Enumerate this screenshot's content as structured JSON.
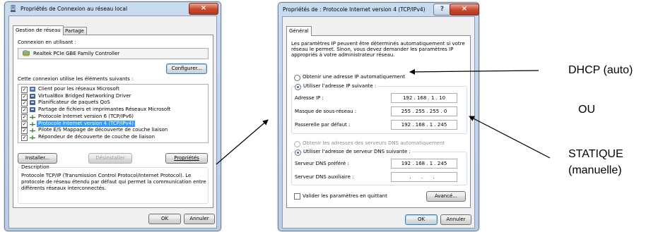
{
  "left_dialog": {
    "title": "Propriétés de Connexion au réseau local",
    "close_glyph": "×",
    "tabs": [
      "Gestion de réseau",
      "Partage"
    ],
    "connect_using_label": "Connexion en utilisant :",
    "adapter_name": "Realtek PCIe GBE Family Controller",
    "configure_button": "Configurer...",
    "items_label": "Cette connexion utilise les éléments suivants :",
    "items": [
      {
        "label": "Client pour les réseaux Microsoft",
        "checked": true,
        "icon": "network-client-icon"
      },
      {
        "label": "VirtualBox Bridged Networking Driver",
        "checked": true,
        "icon": "service-icon"
      },
      {
        "label": "Planificateur de paquets QoS",
        "checked": true,
        "icon": "service-icon"
      },
      {
        "label": "Partage de fichiers et imprimantes Réseaux Microsoft",
        "checked": true,
        "icon": "service-icon"
      },
      {
        "label": "Protocole Internet version 6 (TCP/IPv6)",
        "checked": true,
        "icon": "protocol-icon"
      },
      {
        "label": "Protocole Internet version 4 (TCP/IPv4)",
        "checked": true,
        "icon": "protocol-icon",
        "selected": true
      },
      {
        "label": "Pilote E/S Mappage de découverte de couche liaison",
        "checked": true,
        "icon": "protocol-icon"
      },
      {
        "label": "Répondeur de découverte de couche de liaison",
        "checked": true,
        "icon": "protocol-icon"
      }
    ],
    "install_button": "Installer...",
    "uninstall_button": "Désinstaller",
    "properties_button": "Propriétés",
    "description_label": "Description",
    "description_text": [
      "Protocole TCP/IP (Transmission Control Protocol/Internet Protocol). Le",
      "protocole de réseau étendu par défaut qui permet la communication entre",
      "différents réseaux interconnectés."
    ],
    "ok_button": "OK",
    "cancel_button": "Annuler"
  },
  "right_dialog": {
    "title": "Propriétés de : Protocole Internet version 4 (TCP/IPv4)",
    "help_glyph": "?",
    "close_glyph": "×",
    "tab": "Général",
    "intro_text": [
      "Les paramètres IP peuvent être déterminés automatiquement si votre",
      "réseau le permet. Sinon, vous devez demander les paramètres IP",
      "appropriés à votre administrateur réseau."
    ],
    "auto_ip_label": "Obtenir une adresse IP automatiquement",
    "manual_ip_label": "Utiliser l'adresse IP suivante :",
    "ip_address_label": "Adresse IP :",
    "ip_address_value": "192 . 168 . 1 . 10",
    "subnet_label": "Masque de sous-réseau :",
    "subnet_value": "255 . 255 . 255 . 0",
    "gateway_label": "Passerelle par défaut :",
    "gateway_value": "192 . 168 . 1 . 245",
    "auto_dns_label": "Obtenir les adresses des serveurs DNS automatiquement",
    "manual_dns_label": "Utiliser l'adresse de serveur DNS suivante :",
    "preferred_dns_label": "Serveur DNS préféré :",
    "preferred_dns_value": "192 . 168 . 1 . 245",
    "alternate_dns_label": "Serveur DNS auxiliaire :",
    "alternate_dns_value": ". . .",
    "validate_label": "Valider les paramètres en quittant",
    "advanced_button": "Avancé...",
    "ok_button": "OK",
    "cancel_button": "Annuler"
  },
  "annotations": {
    "dhcp": "DHCP (auto)",
    "ou": "OU",
    "static_line1": "STATIQUE",
    "static_line2": "(manuelle)"
  },
  "colors": {
    "selection": "#3399ff",
    "title_gradient_top": "#c9dbee",
    "close_red": "#c7462e"
  }
}
